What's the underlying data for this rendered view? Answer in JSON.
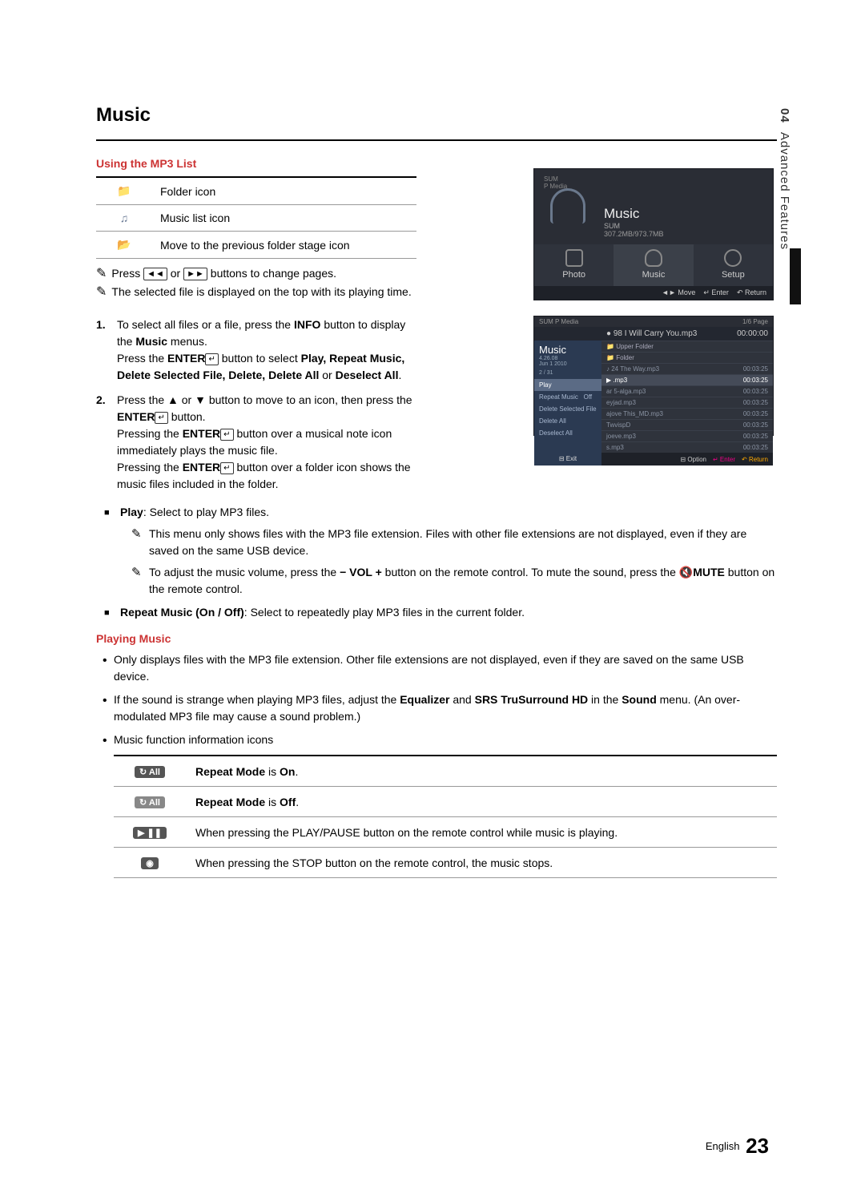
{
  "sidebar": {
    "chapter_num": "04",
    "chapter_title": "Advanced Features"
  },
  "section_title": "Music",
  "sub1": "Using the MP3 List",
  "icon_table": [
    {
      "label": "Folder icon"
    },
    {
      "label": "Music list icon"
    },
    {
      "label": "Move to the previous folder stage icon"
    }
  ],
  "note_press_pages_a": "Press ",
  "note_press_pages_b": " or ",
  "note_press_pages_c": " buttons to change pages.",
  "note_selected": "The selected file is displayed on the top with its playing time.",
  "steps": [
    {
      "p1a": "To select all files or a file, press the ",
      "p1b": "INFO",
      "p1c": " button to display the ",
      "p1d": "Music",
      "p1e": " menus.",
      "p2a": "Press the ",
      "p2b": "ENTER",
      "p2c": " button to select ",
      "p2d": "Play, Repeat Music, Delete Selected File, Delete, Delete All",
      "p2e": " or ",
      "p2f": "Deselect All",
      "p2g": "."
    },
    {
      "p1a": "Press the ▲ or ▼ button to move to an icon, then press the ",
      "p1b": "ENTER",
      "p1c": " button.",
      "p2a": "Pressing the ",
      "p2b": "ENTER",
      "p2c": " button over a musical note icon immediately plays the music file.",
      "p3a": "Pressing the ",
      "p3b": "ENTER",
      "p3c": " button over a folder icon shows the music files included in the folder."
    }
  ],
  "sq_items": [
    {
      "lead": "Play",
      "rest": ": Select to play MP3 files.",
      "subs": [
        "This menu only shows files with the MP3 file extension. Files with other file extensions are not displayed, even if they are saved on the same USB device.",
        "__VOL__"
      ],
      "vol_a": "To adjust the music volume, press the ",
      "vol_b": " button on the remote control. To mute the sound, press the ",
      "vol_c": "MUTE",
      "vol_d": " button on the remote control."
    },
    {
      "lead": "Repeat Music (On / Off)",
      "rest": ": Select to repeatedly play MP3 files in the current folder."
    }
  ],
  "sub2": "Playing Music",
  "bullets": [
    "Only displays files with the MP3 file extension. Other file extensions are not displayed, even if they are saved on the same USB device.",
    "__EQ__",
    "Music function information icons"
  ],
  "eq_a": "If the sound is strange when playing MP3 files, adjust the ",
  "eq_b": "Equalizer",
  "eq_c": " and ",
  "eq_d": "SRS TruSurround HD",
  "eq_e": " in the ",
  "eq_f": "Sound",
  "eq_g": " menu. (An over-modulated MP3 file may cause a sound problem.)",
  "info_table": [
    {
      "badge": "↻ All",
      "badge_class": "",
      "text_a": "Repeat Mode",
      "text_b": " is ",
      "text_c": "On",
      "text_d": "."
    },
    {
      "badge": "↻  All",
      "badge_class": "light",
      "text_a": "Repeat Mode",
      "text_b": " is ",
      "text_c": "Off",
      "text_d": "."
    },
    {
      "badge": "▶ ❚❚",
      "badge_class": "",
      "plain": "When pressing the PLAY/PAUSE button on the remote control while music is playing."
    },
    {
      "badge": "◉",
      "badge_class": "",
      "plain": "When pressing the STOP button on the remote control, the music stops."
    }
  ],
  "footer": {
    "lang": "English",
    "page": "23"
  },
  "shot1": {
    "src_label": "SUM\nP Media",
    "title": "Music",
    "sum": "SUM",
    "size": "307.2MB/973.7MB",
    "tabs": [
      "Photo",
      "Music",
      "Setup"
    ],
    "foot": {
      "move": "Move",
      "enter": "Enter",
      "ret": "Return"
    }
  },
  "shot2": {
    "src_label": "SUM  P Media",
    "page_ind": "1/6 Page",
    "title": "Music",
    "date": "4.26.08\nJun 1 2010",
    "count": "2 / 31",
    "menu": [
      "Play",
      "Repeat Music",
      "Delete Selected File",
      "Delete All",
      "Deselect All"
    ],
    "menu_val": "Off",
    "now_playing": "98 I Will Carry You.mp3",
    "now_time": "00:00:00",
    "rows": [
      {
        "name": "Upper Folder",
        "time": ""
      },
      {
        "name": "Folder",
        "time": ""
      },
      {
        "name": "24 The Way.mp3",
        "time": "00:03:25"
      },
      {
        "name": ".mp3",
        "time": "00:03:25"
      },
      {
        "name": "ar 5-alga.mp3",
        "time": "00:03:25"
      },
      {
        "name": "eyjad.mp3",
        "time": "00:03:25"
      },
      {
        "name": "ajove This_MD.mp3",
        "time": "00:03:25"
      },
      {
        "name": "TwvispD",
        "time": "00:03:25"
      },
      {
        "name": "joeve.mp3",
        "time": "00:03:25"
      },
      {
        "name": "s.mp3",
        "time": "00:03:25"
      }
    ],
    "foot": {
      "exit": "Exit",
      "option": "Option",
      "enter": "Enter",
      "ret": "Return"
    }
  }
}
